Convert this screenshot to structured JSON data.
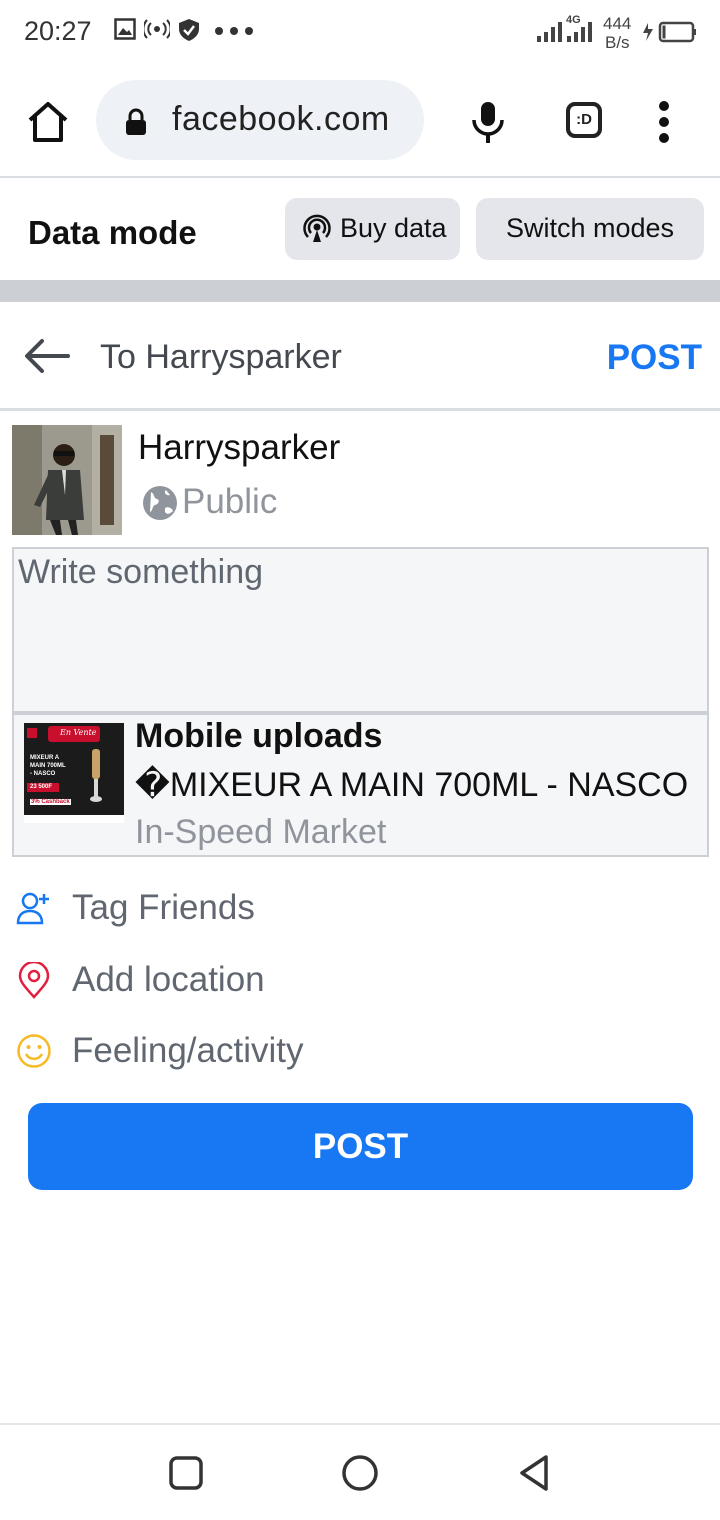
{
  "status_bar": {
    "time": "20:27",
    "network": "4G",
    "speed_value": "444",
    "speed_unit": "B/s",
    "icons": [
      "image-icon",
      "hotspot-icon",
      "shield-icon",
      "more-dots-icon",
      "signal-icon",
      "battery-charging-icon"
    ]
  },
  "browser": {
    "url": "facebook.com",
    "tab_label": ":D",
    "icons": [
      "home-icon",
      "lock-icon",
      "mic-icon",
      "tab-switcher-icon",
      "overflow-menu-icon"
    ]
  },
  "data_mode": {
    "title": "Data mode",
    "buy_label": "Buy data",
    "switch_label": "Switch modes"
  },
  "composer": {
    "to_label": "To Harrysparker",
    "post_label": "POST"
  },
  "user": {
    "name": "Harrysparker",
    "privacy": "Public"
  },
  "input": {
    "placeholder": "Write something"
  },
  "attachment": {
    "title": "Mobile uploads",
    "description": "�MIXEUR A MAIN 700ML - NASCO",
    "source": "In-Speed Market",
    "thumb": {
      "banner": "En Vente",
      "line1": "MIXEUR A",
      "line2": "MAIN 700ML",
      "line3": "- NASCO",
      "price": "23 500F",
      "cashback": "3% Cashback"
    }
  },
  "options": {
    "tag": "Tag Friends",
    "location": "Add location",
    "feeling": "Feeling/activity"
  },
  "post_button": "POST",
  "colors": {
    "accent": "#1877f2",
    "location_icon": "#e41e3f",
    "feeling_icon": "#f7b928",
    "tag_icon": "#1877f2"
  }
}
